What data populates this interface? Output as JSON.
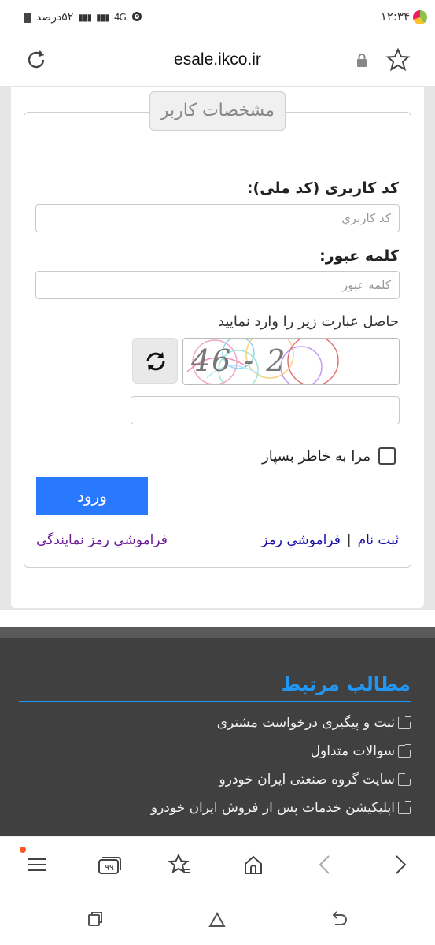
{
  "status_bar": {
    "time": "۱۲:۳۴",
    "battery_text": "۵۲درصد",
    "network": "4G"
  },
  "url_bar": {
    "url": "esale.ikco.ir"
  },
  "form": {
    "legend": "مشخصات کاربر",
    "username_label": "کد کاربری (کد ملی):",
    "username_placeholder": "کد کاربري",
    "password_label": "کلمه عبور:",
    "password_placeholder": "کلمه عبور",
    "captcha_hint": "حاصل عبارت زیر را وارد نمایید",
    "captcha_text": "46 - 2",
    "remember_label": "مرا به خاطر بسپار",
    "login_button": "ورود",
    "register_link": "ثبت نام",
    "separator": "|",
    "forgot_password_link": "فراموشي رمز",
    "forgot_agency_password_link": "فراموشي رمز نمایندگی"
  },
  "footer": {
    "related_title": "مطالب مرتبط",
    "items": [
      "ثبت و پیگیری درخواست مشتری",
      "سوالات متداول",
      "سایت گروه صنعتی ایران خودرو",
      "اپلیکیشن خدمات پس از فروش ایران خودرو"
    ]
  },
  "browser_bar": {
    "tabs_count": "۹۹"
  },
  "colors": {
    "login_button": "#2979ff",
    "related_title": "#2196f3",
    "footer_bg": "#404040"
  }
}
